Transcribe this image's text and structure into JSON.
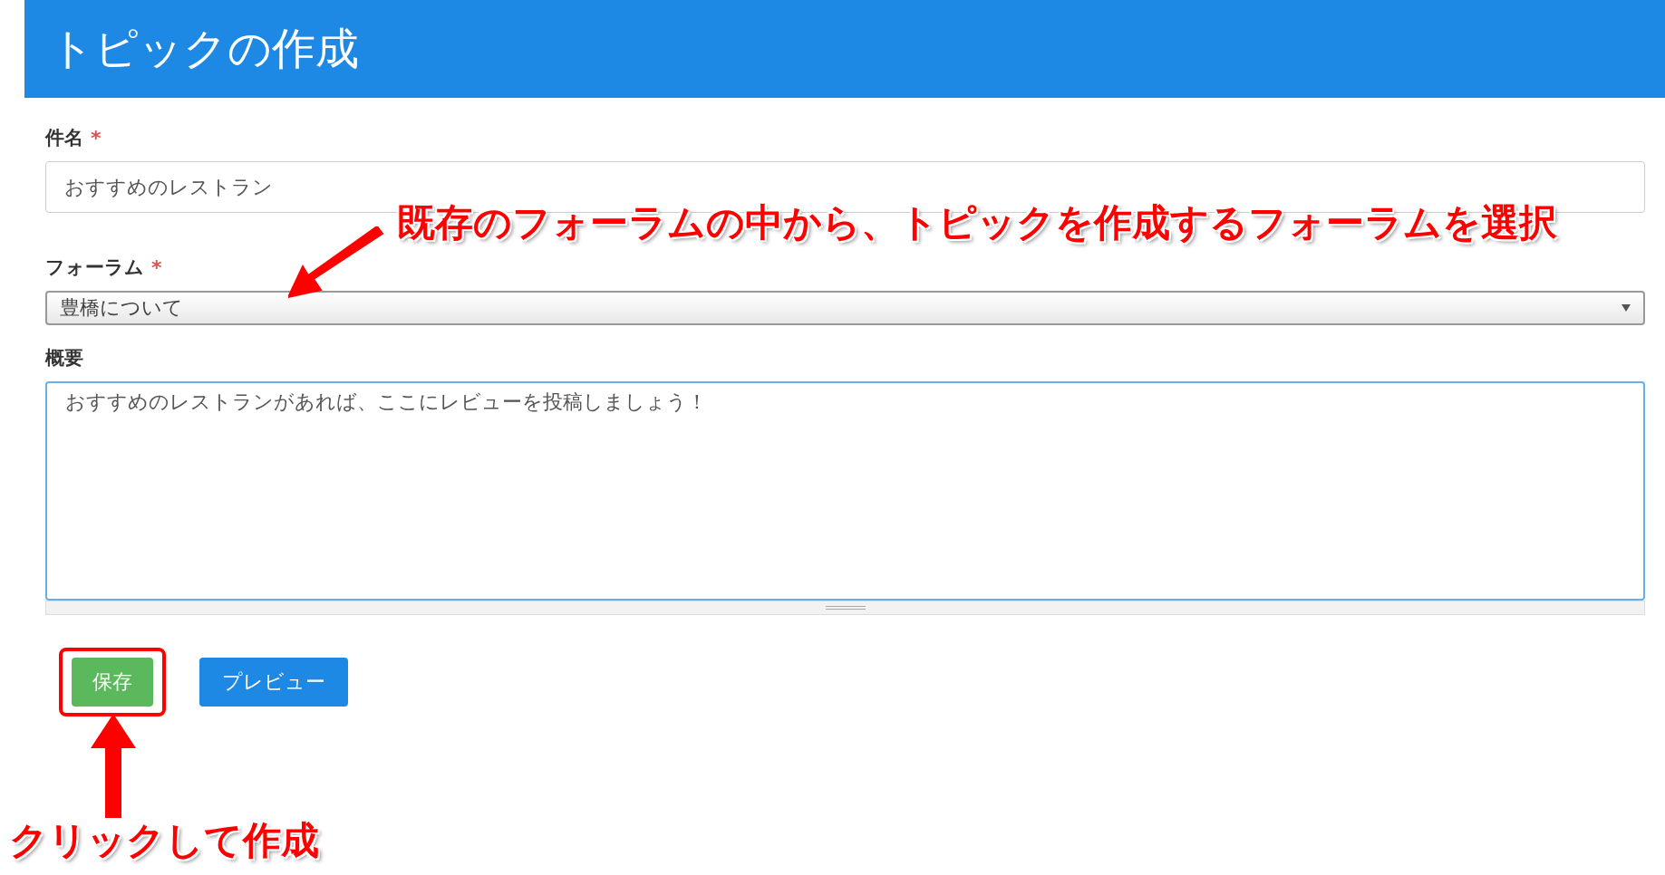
{
  "header": {
    "title": "トピックの作成"
  },
  "fields": [
    {
      "kind": "input",
      "label": "件名",
      "required_mark": "*",
      "value": "おすすめのレストラン"
    },
    {
      "kind": "select",
      "label": "フォーラム",
      "required_mark": "*",
      "value": "豊橋について"
    },
    {
      "kind": "textarea",
      "label": "概要",
      "value": "おすすめのレストランがあれば、ここにレビューを投稿しましょう！"
    }
  ],
  "buttons": [
    {
      "kind": "save",
      "label": "保存"
    },
    {
      "kind": "preview",
      "label": "プレビュー"
    }
  ],
  "annotations": [
    {
      "kind": "forum",
      "text": "既存のフォーラムの中から、トピックを作成するフォーラムを選択"
    },
    {
      "kind": "save",
      "text": "クリックして作成"
    }
  ]
}
